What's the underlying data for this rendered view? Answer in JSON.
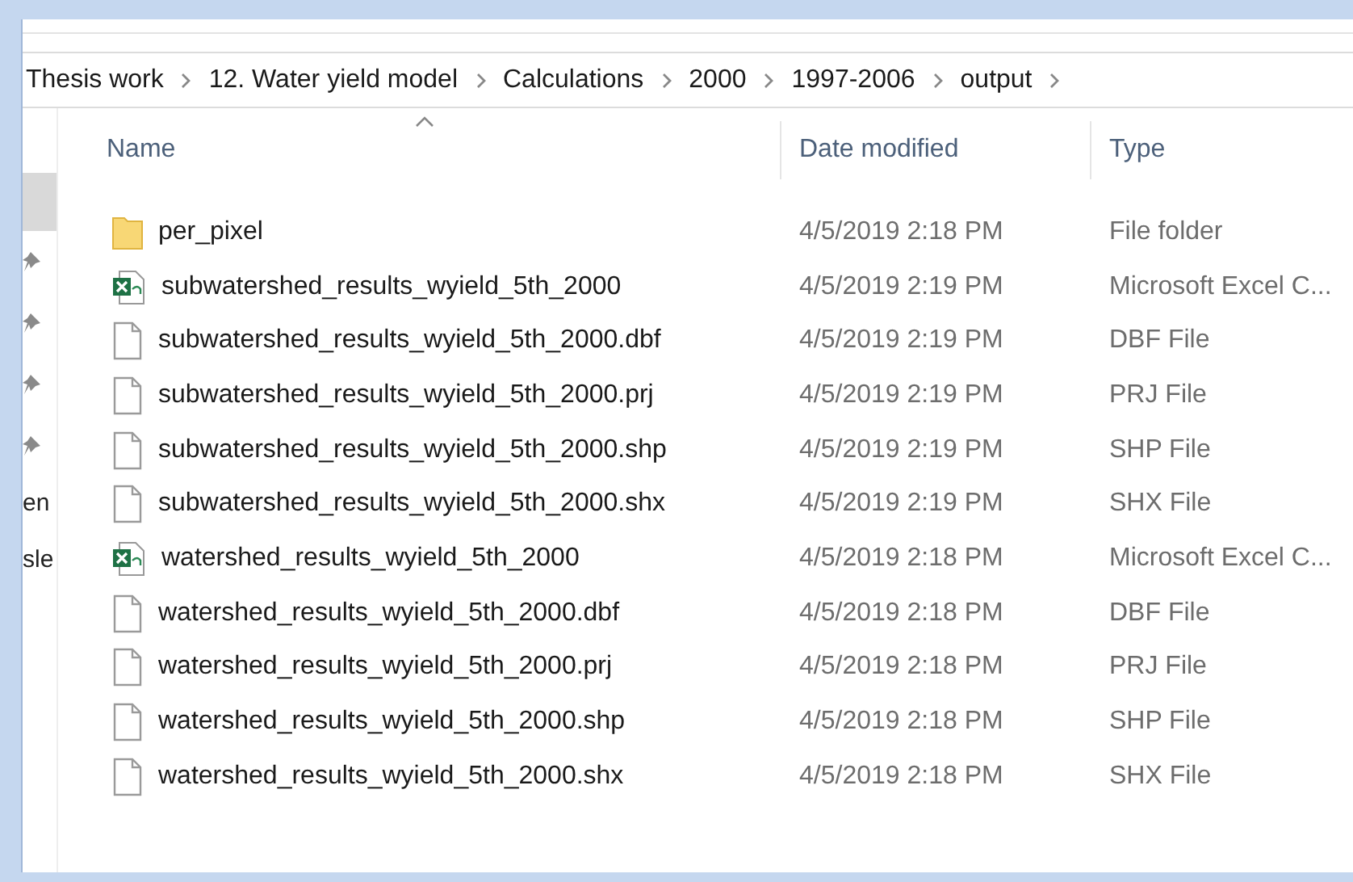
{
  "breadcrumb": [
    "Thesis work",
    "12. Water yield model",
    "Calculations",
    "2000",
    "1997-2006",
    "output"
  ],
  "sidebar": {
    "items": [
      {
        "kind": "blank",
        "selected": true
      },
      {
        "kind": "pin",
        "selected": false
      },
      {
        "kind": "pin",
        "selected": false
      },
      {
        "kind": "pin",
        "selected": false
      },
      {
        "kind": "pin",
        "selected": false
      },
      {
        "kind": "text",
        "label": "en",
        "selected": false
      },
      {
        "kind": "text",
        "label": "sle",
        "selected": false
      }
    ]
  },
  "table": {
    "columns": [
      "Name",
      "Date modified",
      "Type"
    ],
    "rows": [
      {
        "kind": "folder",
        "name": "per_pixel",
        "date": "4/5/2019 2:18 PM",
        "type": "File folder"
      },
      {
        "kind": "excel",
        "name": "subwatershed_results_wyield_5th_2000",
        "date": "4/5/2019 2:19 PM",
        "type": "Microsoft Excel C..."
      },
      {
        "kind": "file",
        "name": "subwatershed_results_wyield_5th_2000.dbf",
        "date": "4/5/2019 2:19 PM",
        "type": "DBF File"
      },
      {
        "kind": "file",
        "name": "subwatershed_results_wyield_5th_2000.prj",
        "date": "4/5/2019 2:19 PM",
        "type": "PRJ File"
      },
      {
        "kind": "file",
        "name": "subwatershed_results_wyield_5th_2000.shp",
        "date": "4/5/2019 2:19 PM",
        "type": "SHP File"
      },
      {
        "kind": "file",
        "name": "subwatershed_results_wyield_5th_2000.shx",
        "date": "4/5/2019 2:19 PM",
        "type": "SHX File"
      },
      {
        "kind": "excel",
        "name": "watershed_results_wyield_5th_2000",
        "date": "4/5/2019 2:18 PM",
        "type": "Microsoft Excel C..."
      },
      {
        "kind": "file",
        "name": "watershed_results_wyield_5th_2000.dbf",
        "date": "4/5/2019 2:18 PM",
        "type": "DBF File"
      },
      {
        "kind": "file",
        "name": "watershed_results_wyield_5th_2000.prj",
        "date": "4/5/2019 2:18 PM",
        "type": "PRJ File"
      },
      {
        "kind": "file",
        "name": "watershed_results_wyield_5th_2000.shp",
        "date": "4/5/2019 2:18 PM",
        "type": "SHP File"
      },
      {
        "kind": "file",
        "name": "watershed_results_wyield_5th_2000.shx",
        "date": "4/5/2019 2:18 PM",
        "type": "SHX File"
      }
    ]
  }
}
